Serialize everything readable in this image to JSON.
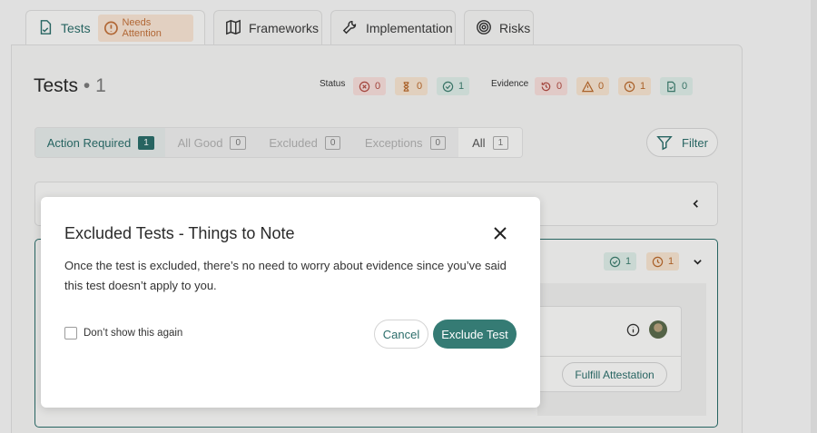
{
  "tabs": [
    {
      "label": "Tests",
      "badge": "Needs Attention",
      "icon": "test-doc-icon"
    },
    {
      "label": "Frameworks",
      "icon": "map-icon"
    },
    {
      "label": "Implementation",
      "icon": "wrench-icon"
    },
    {
      "label": "Risks",
      "icon": "target-icon"
    }
  ],
  "header": {
    "title": "Tests",
    "separator": "•",
    "count": "1",
    "status_label": "Status",
    "status_chips": [
      {
        "icon": "x-circle-icon",
        "value": "0",
        "color": "#b04a42"
      },
      {
        "icon": "hourglass-icon",
        "value": "0",
        "color": "#b8692c"
      },
      {
        "icon": "check-circle-icon",
        "value": "1",
        "color": "#3d7d6f"
      }
    ],
    "evidence_label": "Evidence",
    "evidence_chips": [
      {
        "icon": "history-icon",
        "value": "0",
        "color": "#b04a42"
      },
      {
        "icon": "warning-icon",
        "value": "0",
        "color": "#b8692c"
      },
      {
        "icon": "clock-icon",
        "value": "1",
        "color": "#b8692c"
      },
      {
        "icon": "doc-icon",
        "value": "0",
        "color": "#3d7d6f"
      }
    ]
  },
  "filters": [
    {
      "label": "Action Required",
      "count": "1"
    },
    {
      "label": "All Good",
      "count": "0"
    },
    {
      "label": "Excluded",
      "count": "0"
    },
    {
      "label": "Exceptions",
      "count": "0"
    },
    {
      "label": "All",
      "count": "1"
    }
  ],
  "filter_button": "Filter",
  "test_card": {
    "check_count": "1",
    "clock_count": "1",
    "fulfill_label": "Fulfill Attestation"
  },
  "modal": {
    "title": "Excluded Tests - Things to Note",
    "body": "Once the test is excluded, there’s no need to worry about evidence since you’ve said this test doesn’t apply to you.",
    "checkbox_label": "Don’t show this again",
    "cancel": "Cancel",
    "confirm": "Exclude Test"
  },
  "colors": {
    "accent": "#2b6d6a",
    "primary_button": "#357b74"
  }
}
